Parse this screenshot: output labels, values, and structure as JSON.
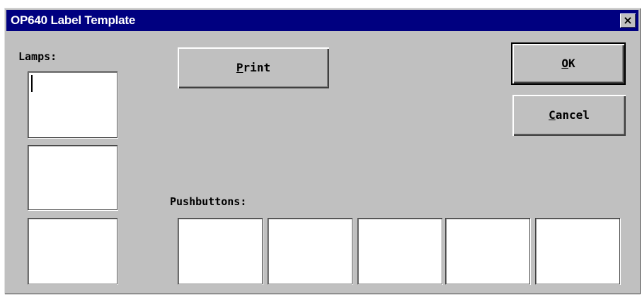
{
  "window": {
    "title": "OP640 Label Template",
    "close_glyph": "×"
  },
  "lamps": {
    "label": "Lamps:",
    "count": 3
  },
  "pushbuttons": {
    "label": "Pushbuttons:",
    "count": 5
  },
  "buttons": {
    "print": {
      "mnemonic": "P",
      "rest": "rint"
    },
    "ok": {
      "mnemonic": "O",
      "rest": "K"
    },
    "cancel": {
      "mnemonic": "C",
      "rest": "ancel"
    }
  },
  "colors": {
    "titlebar": "#000080",
    "face": "#c0c0c0",
    "field": "#ffffff"
  }
}
